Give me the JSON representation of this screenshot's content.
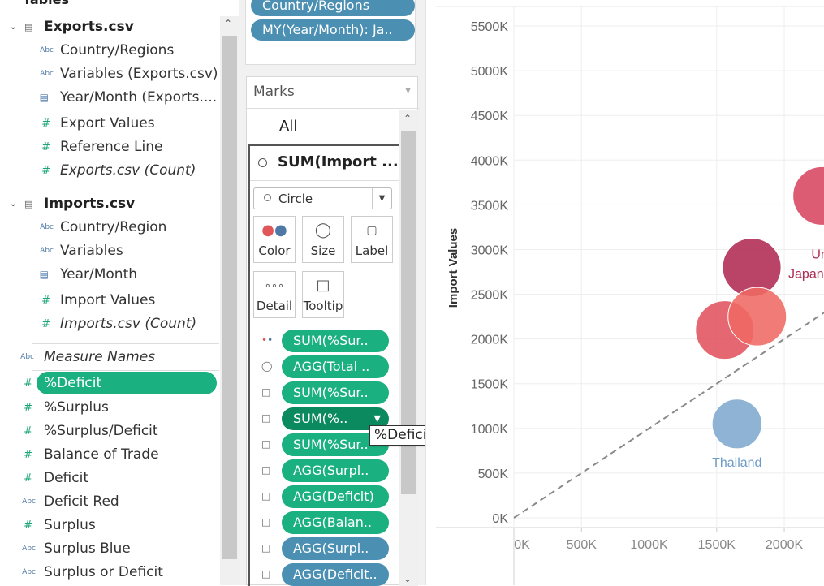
{
  "data_pane": {
    "tables_header": "Tables",
    "exports_table": {
      "name": "Exports.csv",
      "fields": [
        "Country/Regions",
        "Variables (Exports.csv)",
        "Year/Month (Exports...."
      ],
      "measures": [
        "Export Values",
        "Reference Line",
        "Exports.csv (Count)"
      ]
    },
    "imports_table": {
      "name": "Imports.csv",
      "fields": [
        "Country/Region",
        "Variables",
        "Year/Month"
      ],
      "measures": [
        "Import Values",
        "Imports.csv (Count)"
      ]
    },
    "extra_fields": [
      "Measure Names",
      "%Deficit",
      "%Surplus",
      "%Surplus/Deficit",
      "Balance of Trade",
      "Deficit",
      "Deficit Red",
      "Surplus",
      "Surplus Blue",
      "Surplus or Deficit"
    ],
    "icon_abc": "Abc",
    "icon_hash": "#",
    "icon_cal": "▤"
  },
  "shelf": {
    "pill1": "Country/Regions",
    "pill2": "MY(Year/Month): Ja.."
  },
  "marks": {
    "title": "Marks",
    "all": "All",
    "measure": "SUM(Import ...",
    "mark_type": "Circle",
    "buttons": {
      "color": "Color",
      "size": "Size",
      "label": "Label",
      "detail": "Detail",
      "tooltip": "Tooltip"
    },
    "pills": [
      "SUM(%Sur..",
      "AGG(Total ..",
      "SUM(%Sur..",
      "SUM(%..",
      "SUM(%Sur..",
      "AGG(Surpl..",
      "AGG(Deficit)",
      "AGG(Balan..",
      "AGG(Surpl..",
      "AGG(Deficit.."
    ],
    "hover_tooltip": "%Deficit"
  },
  "chart_data": {
    "type": "scatter",
    "ylabel": "Import Values",
    "xlabel": "",
    "y_ticks": [
      "0K",
      "500K",
      "1000K",
      "1500K",
      "2000K",
      "2500K",
      "3000K",
      "3500K",
      "4000K",
      "4500K",
      "5000K",
      "5500K"
    ],
    "x_ticks": [
      "0K",
      "500K",
      "1000K",
      "1500K",
      "2000K"
    ],
    "ylim": [
      0,
      5700000
    ],
    "xlim": [
      0,
      2300000
    ],
    "grid": true,
    "reference_line": "y = x (dashed)",
    "points": [
      {
        "label": "",
        "x": 1760000,
        "y": 2800000,
        "size": 1.0,
        "color": "#b02a52"
      },
      {
        "label": "",
        "x": 1560000,
        "y": 2100000,
        "size": 1.0,
        "color": "#e0525d"
      },
      {
        "label": "",
        "x": 1800000,
        "y": 2250000,
        "size": 1.0,
        "color": "#ef6a64"
      },
      {
        "label": "Thailand",
        "x": 1650000,
        "y": 1050000,
        "size": 0.85,
        "color": "#7ea9cf"
      },
      {
        "label": "",
        "x": 2280000,
        "y": 3600000,
        "size": 1.0,
        "color": "#d64560"
      }
    ],
    "annotations": [
      {
        "text": "Un",
        "x": 2200000,
        "y": 2900000,
        "color": "#b02a52"
      },
      {
        "text": "Japan",
        "x": 2030000,
        "y": 2680000,
        "color": "#b02a52"
      }
    ]
  }
}
